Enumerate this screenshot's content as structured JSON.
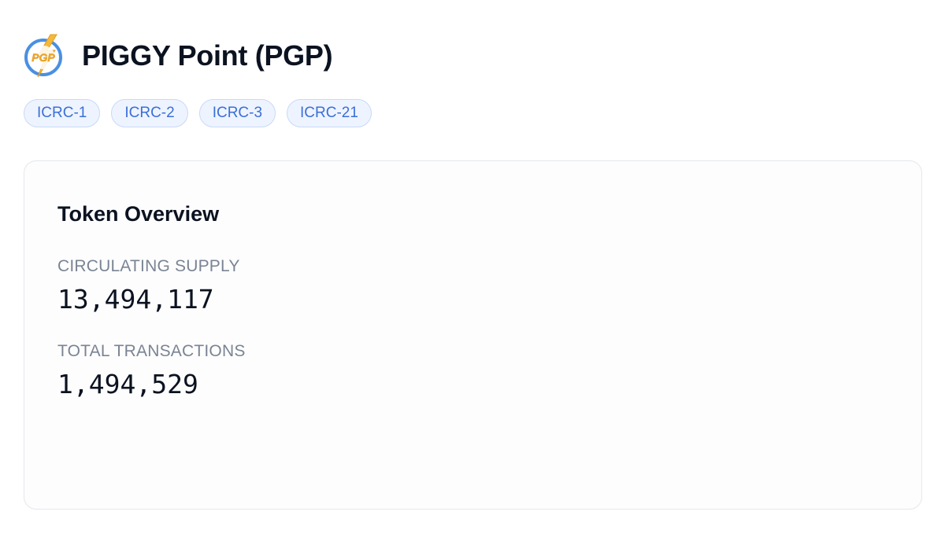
{
  "token": {
    "logo_icon": "pgp-lightning-coin-icon",
    "logo_text": "PGP",
    "name": "PIGGY Point (PGP)"
  },
  "standards": [
    "ICRC-1",
    "ICRC-2",
    "ICRC-3",
    "ICRC-21"
  ],
  "overview": {
    "title": "Token Overview",
    "circulating_supply_label": "CIRCULATING SUPPLY",
    "circulating_supply_value": "13,494,117",
    "total_transactions_label": "TOTAL TRANSACTIONS",
    "total_transactions_value": "1,494,529"
  },
  "colors": {
    "chip_bg": "#eef4ff",
    "chip_border": "#c9d9f6",
    "chip_text": "#3b6fd6",
    "logo_ring": "#4a90e2",
    "logo_bolt": "#f5b93a",
    "label_gray": "#7a8494"
  }
}
